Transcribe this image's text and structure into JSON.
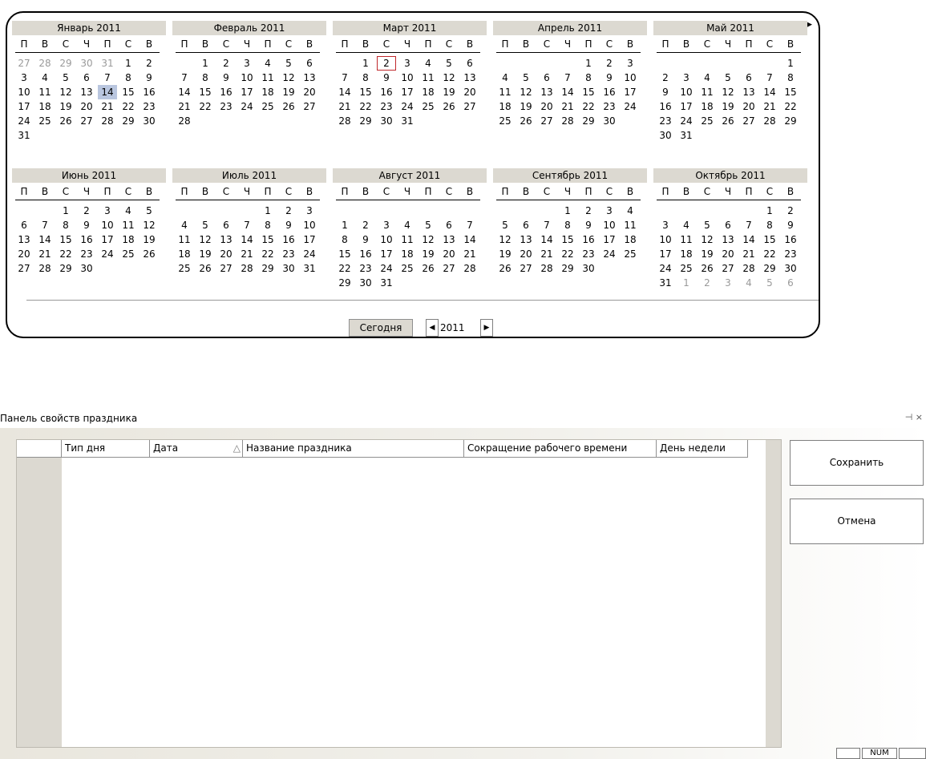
{
  "calendar": {
    "dow": [
      "П",
      "В",
      "С",
      "Ч",
      "П",
      "С",
      "В"
    ],
    "months": [
      {
        "title": "Январь 2011",
        "offset": 0,
        "days": 31,
        "lead": [
          27,
          28,
          29,
          30,
          31
        ],
        "trail": []
      },
      {
        "title": "Февраль 2011",
        "offset": 1,
        "days": 28,
        "lead": [],
        "trail": []
      },
      {
        "title": "Март 2011",
        "offset": 1,
        "days": 31,
        "lead": [],
        "trail": []
      },
      {
        "title": "Апрель 2011",
        "offset": 4,
        "days": 30,
        "lead": [],
        "trail": []
      },
      {
        "title": "Май 2011",
        "offset": 6,
        "days": 31,
        "lead": [],
        "trail": []
      },
      {
        "title": "Июнь 2011",
        "offset": 2,
        "days": 30,
        "lead": [],
        "trail": []
      },
      {
        "title": "Июль 2011",
        "offset": 4,
        "days": 31,
        "lead": [],
        "trail": []
      },
      {
        "title": "Август 2011",
        "offset": 7,
        "days": 31,
        "lead": [],
        "trail": []
      },
      {
        "title": "Сентябрь 2011",
        "offset": 3,
        "days": 30,
        "lead": [],
        "trail": []
      },
      {
        "title": "Октябрь 2011",
        "offset": 5,
        "days": 31,
        "lead": [],
        "trail": [
          1,
          2,
          3,
          4,
          5,
          6
        ]
      }
    ],
    "today_marker": {
      "month_index": 0,
      "day": 14
    },
    "selected_marker": {
      "month_index": 2,
      "day": 2
    },
    "today_label": "Сегодня",
    "year_value": "2011"
  },
  "panel": {
    "title": "Панель свойств праздника",
    "pin_close": "⊣ ×",
    "columns": [
      "Тип дня",
      "Дата",
      "Название праздника",
      "Сокращение рабочего времени",
      "День недели"
    ],
    "save_label": "Сохранить",
    "cancel_label": "Отмена"
  },
  "statusbar": {
    "num": "NUM"
  }
}
